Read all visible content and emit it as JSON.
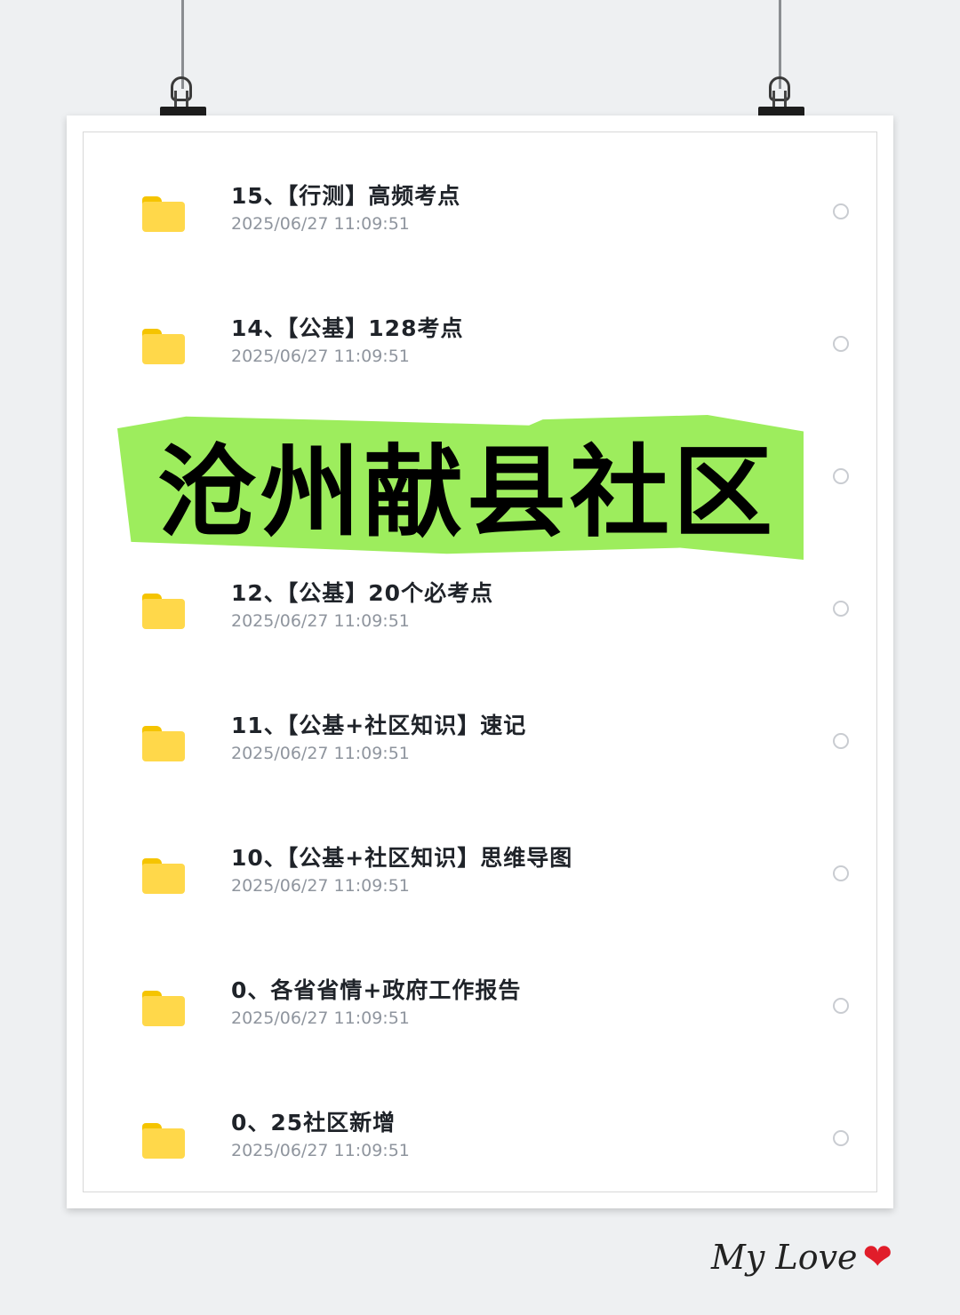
{
  "list": {
    "items": [
      {
        "title": "15、【行测】高频考点",
        "date": "2025/06/27 11:09:51"
      },
      {
        "title": "14、【公基】128考点",
        "date": "2025/06/27 11:09:51"
      },
      {
        "title": "",
        "date": ""
      },
      {
        "title": "12、【公基】20个必考点",
        "date": "2025/06/27 11:09:51"
      },
      {
        "title": "11、【公基+社区知识】速记",
        "date": "2025/06/27 11:09:51"
      },
      {
        "title": "10、【公基+社区知识】思维导图",
        "date": "2025/06/27 11:09:51"
      },
      {
        "title": "0、各省省情+政府工作报告",
        "date": "2025/06/27 11:09:51"
      },
      {
        "title": "0、25社区新增",
        "date": "2025/06/27 11:09:51"
      }
    ]
  },
  "banner": {
    "text": "沧州献县社区",
    "color": "#9ded5d"
  },
  "signature": {
    "text": "My Love",
    "heart": "❤"
  },
  "colors": {
    "folder": "#ffd84a",
    "background": "#eef0f2"
  },
  "icons": {
    "folder": "folder-icon",
    "radio": "radio-circle-icon",
    "clip": "binder-clip-icon"
  }
}
